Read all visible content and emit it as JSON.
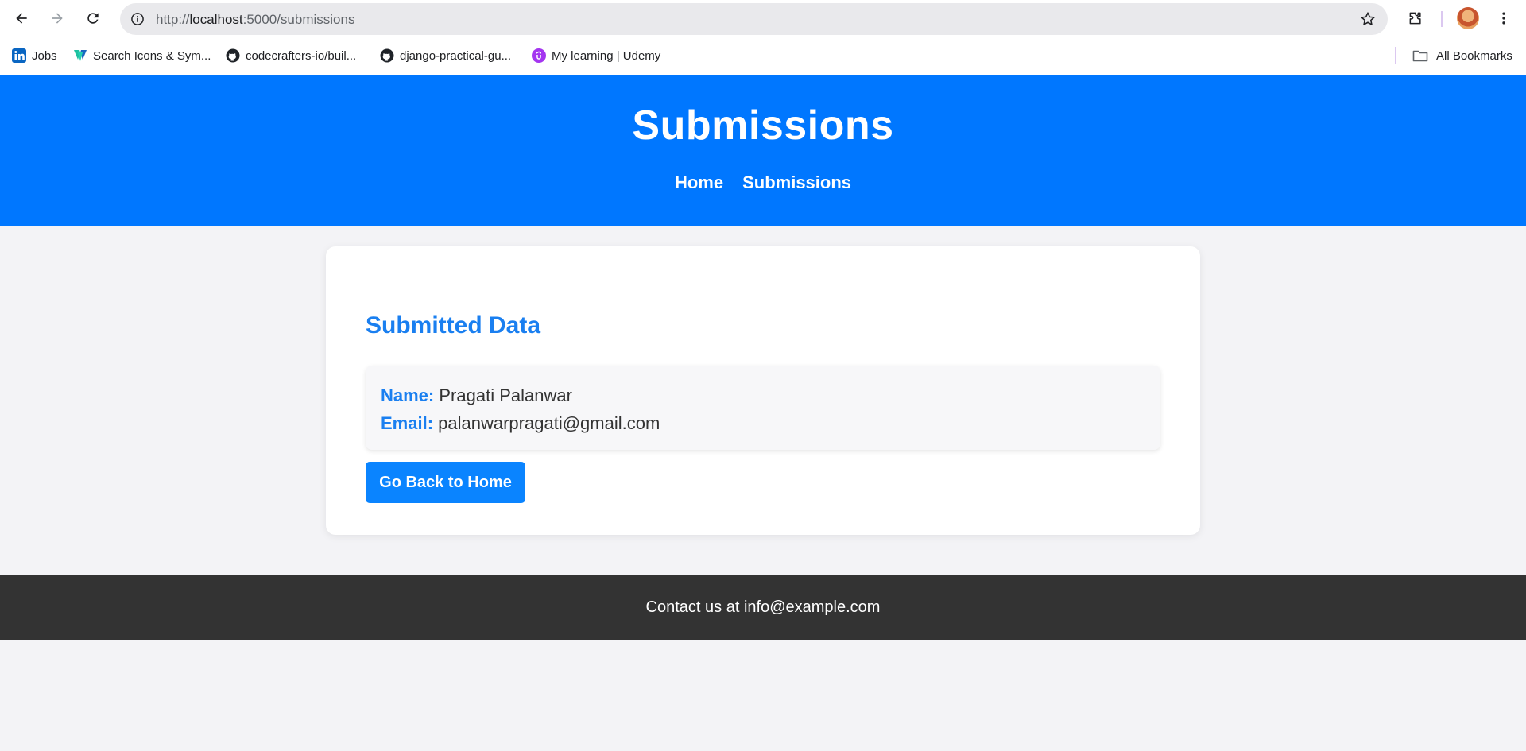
{
  "browser": {
    "url_scheme": "http://",
    "url_host": "localhost",
    "url_path": ":5000/submissions",
    "icons": {
      "back": "arrow-left-icon",
      "forward": "arrow-right-icon",
      "reload": "reload-icon",
      "site_info": "info-icon",
      "bookmark_star": "star-icon",
      "extensions": "puzzle-icon",
      "menu": "kebab-menu-icon"
    }
  },
  "bookmarks": {
    "items": [
      {
        "label": "Jobs",
        "icon": "linkedin-icon"
      },
      {
        "label": "Search Icons & Sym...",
        "icon": "vuetify-icon"
      },
      {
        "label": "codecrafters-io/buil...",
        "icon": "github-icon"
      },
      {
        "label": "django-practical-gu...",
        "icon": "github-icon"
      },
      {
        "label": "My learning | Udemy",
        "icon": "udemy-icon"
      }
    ],
    "all_bookmarks": "All Bookmarks"
  },
  "header": {
    "title": "Submissions",
    "nav": [
      {
        "label": "Home"
      },
      {
        "label": "Submissions"
      }
    ]
  },
  "main": {
    "heading": "Submitted Data",
    "entry": {
      "name_label": "Name:",
      "name_value": "Pragati Palanwar",
      "email_label": "Email:",
      "email_value": "palanwarpragati@gmail.com"
    },
    "back_button": "Go Back to Home"
  },
  "footer": {
    "text": "Contact us at info@example.com"
  },
  "colors": {
    "header_bg": "#0077ff",
    "accent": "#1a7ff0",
    "button_bg": "#0a84ff",
    "footer_bg": "#333333",
    "page_bg": "#f3f3f6"
  }
}
